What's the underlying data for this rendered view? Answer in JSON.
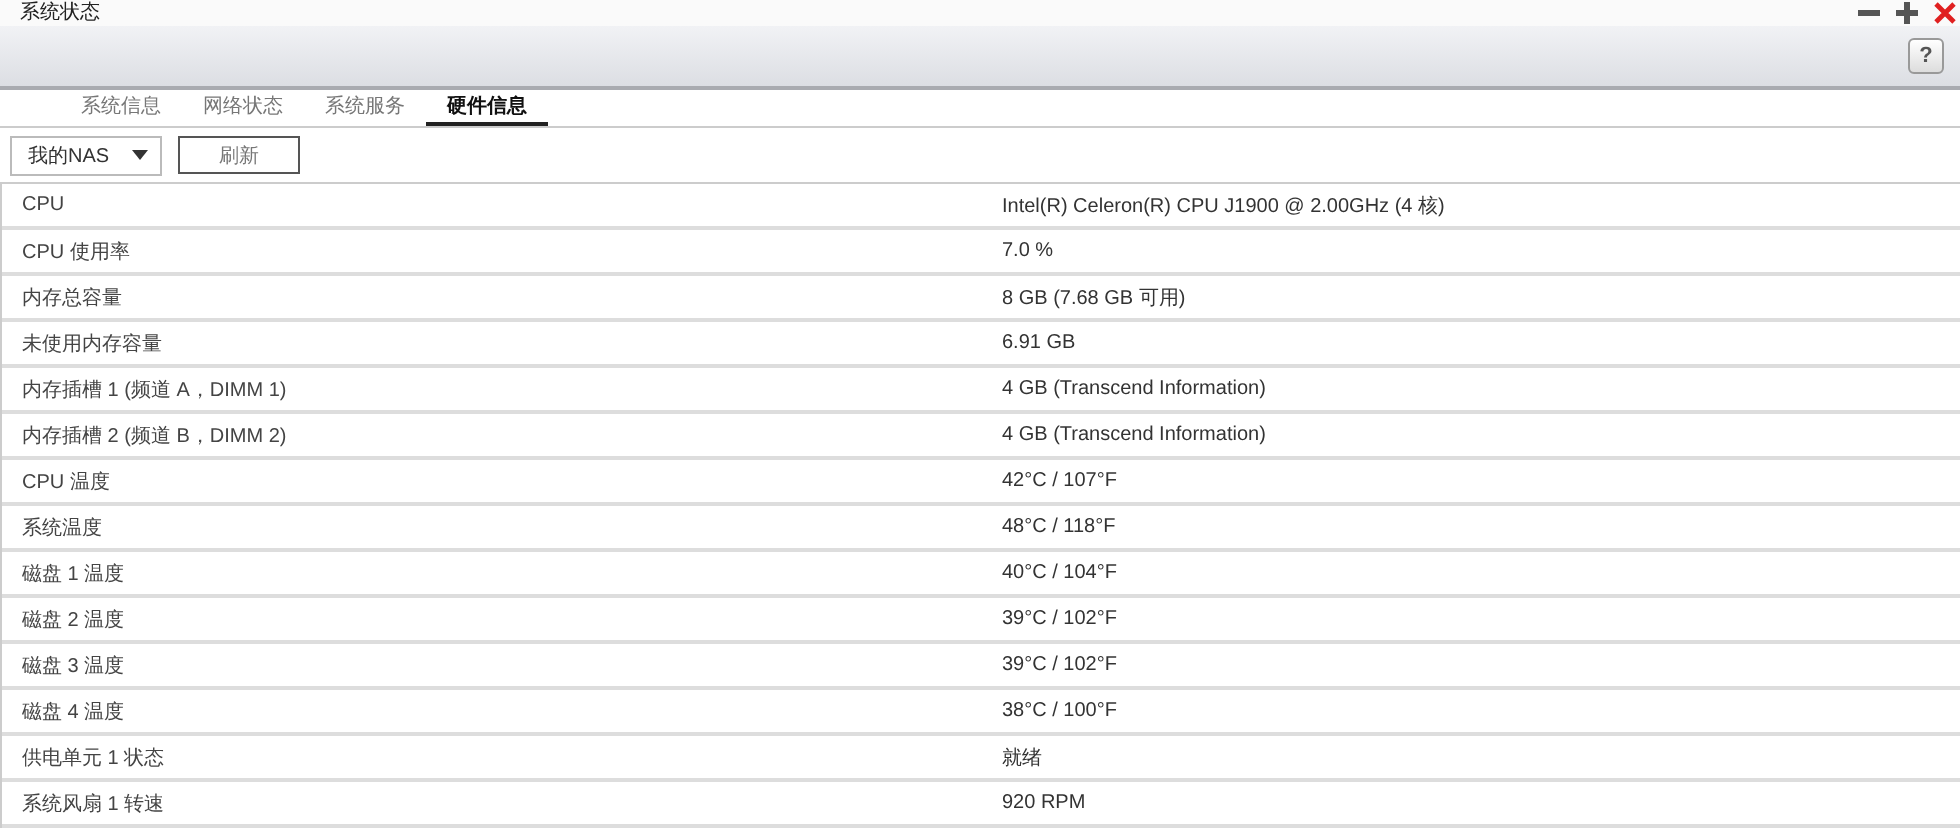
{
  "window": {
    "title": "系统状态",
    "help_label": "?"
  },
  "tabs": [
    {
      "label": "系统信息",
      "selected": false
    },
    {
      "label": "网络状态",
      "selected": false
    },
    {
      "label": "系统服务",
      "selected": false
    },
    {
      "label": "硬件信息",
      "selected": true
    }
  ],
  "toolbar": {
    "device_select": "我的NAS",
    "refresh_button": "刷新"
  },
  "table": {
    "rows": [
      {
        "label": "CPU",
        "value": "Intel(R) Celeron(R) CPU J1900 @ 2.00GHz (4 核)"
      },
      {
        "label": "CPU 使用率",
        "value": "7.0 %"
      },
      {
        "label": "内存总容量",
        "value": "8 GB (7.68 GB 可用)"
      },
      {
        "label": "未使用内存容量",
        "value": "6.91 GB"
      },
      {
        "label": "内存插槽 1 (频道 A，DIMM 1)",
        "value": "4 GB (Transcend Information)"
      },
      {
        "label": "内存插槽 2 (频道 B，DIMM 2)",
        "value": "4 GB (Transcend Information)"
      },
      {
        "label": "CPU 温度",
        "value": "42°C / 107°F"
      },
      {
        "label": "系统温度",
        "value": "48°C / 118°F"
      },
      {
        "label": "磁盘 1 温度",
        "value": "40°C / 104°F"
      },
      {
        "label": "磁盘 2 温度",
        "value": "39°C / 102°F"
      },
      {
        "label": "磁盘 3 温度",
        "value": "39°C / 102°F"
      },
      {
        "label": "磁盘 4 温度",
        "value": "38°C / 100°F"
      },
      {
        "label": "供电单元 1 状态",
        "value": "就绪"
      },
      {
        "label": "系统风扇 1 转速",
        "value": "920 RPM"
      }
    ]
  }
}
